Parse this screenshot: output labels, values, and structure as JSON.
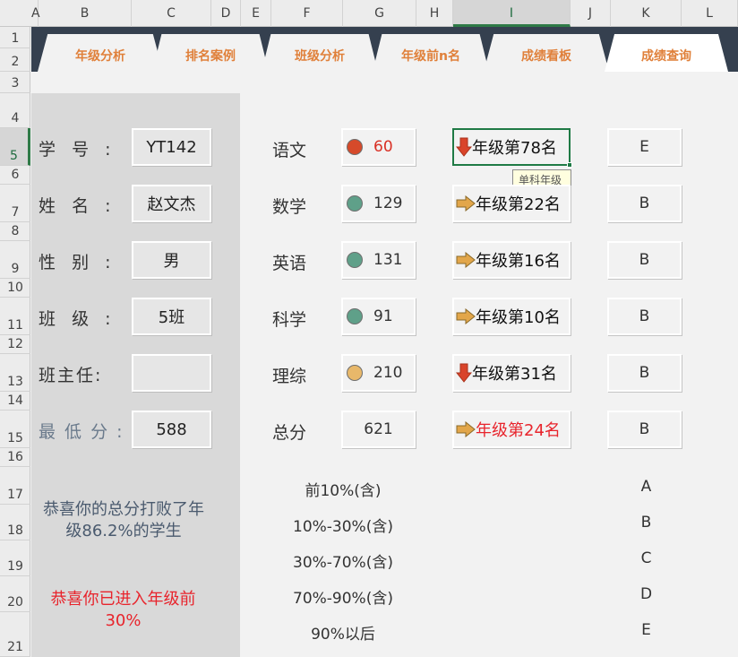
{
  "columns": [
    "A",
    "B",
    "C",
    "D",
    "E",
    "F",
    "G",
    "H",
    "I",
    "J",
    "K",
    "L"
  ],
  "rows": [
    "1",
    "2",
    "3",
    "4",
    "5",
    "6",
    "7",
    "8",
    "9",
    "10",
    "11",
    "12",
    "13",
    "14",
    "15",
    "16",
    "17",
    "18",
    "19",
    "20",
    "21"
  ],
  "tabs": [
    "年级分析",
    "排名案例",
    "班级分析",
    "年级前n名",
    "成绩看板",
    "成绩查询"
  ],
  "student": {
    "id_label": "学  号  :",
    "id_value": "YT142",
    "name_label": "姓  名  :",
    "name_value": "赵文杰",
    "gender_label": "性  别  :",
    "gender_value": "男",
    "class_label": "班  级  :",
    "class_value": "5班",
    "teacher_label": "班主任:",
    "teacher_value": "",
    "min_label": "最 低 分 :",
    "min_value": "588"
  },
  "messages": {
    "beat_percent": "恭喜你的总分打败了年级86.2%的学生",
    "entered_top": "恭喜你已进入年级前30%"
  },
  "subjects": [
    {
      "name": "语文",
      "score": "60",
      "dot": "#d64a2a",
      "score_color": "#d93025",
      "rank_icon": "arrow-down-icon",
      "rank": "年级第78名",
      "rank_color": "#111111",
      "grade": "E"
    },
    {
      "name": "数学",
      "score": "129",
      "dot": "#5fa089",
      "score_color": "#333333",
      "rank_icon": "arrow-right-icon",
      "rank": "年级第22名",
      "rank_color": "#111111",
      "grade": "B"
    },
    {
      "name": "英语",
      "score": "131",
      "dot": "#5fa089",
      "score_color": "#333333",
      "rank_icon": "arrow-right-icon",
      "rank": "年级第16名",
      "rank_color": "#111111",
      "grade": "B"
    },
    {
      "name": "科学",
      "score": "91",
      "dot": "#5fa089",
      "score_color": "#333333",
      "rank_icon": "arrow-right-icon",
      "rank": "年级第10名",
      "rank_color": "#111111",
      "grade": "B"
    },
    {
      "name": "理综",
      "score": "210",
      "dot": "#e8b86a",
      "score_color": "#333333",
      "rank_icon": "arrow-down-icon",
      "rank": "年级第31名",
      "rank_color": "#111111",
      "grade": "B"
    },
    {
      "name": "总分",
      "score": "621",
      "dot": "",
      "score_color": "#333333",
      "rank_icon": "arrow-right-icon",
      "rank": "年级第24名",
      "rank_color": "#e8242c",
      "grade": "B"
    }
  ],
  "comment_tooltip": "单科年级排名",
  "grade_legend": [
    {
      "range": "前10%(含)",
      "grade": "A"
    },
    {
      "range": "10%-30%(含)",
      "grade": "B"
    },
    {
      "range": "30%-70%(含)",
      "grade": "C"
    },
    {
      "range": "70%-90%(含)",
      "grade": "D"
    },
    {
      "range": "90%以后",
      "grade": "E"
    }
  ],
  "colors": {
    "tab_text": "#e0803a",
    "tab_band": "#35404f",
    "arrow_down": "#d9442a",
    "arrow_right": "#e2a64a",
    "selection": "#1f7a45"
  }
}
